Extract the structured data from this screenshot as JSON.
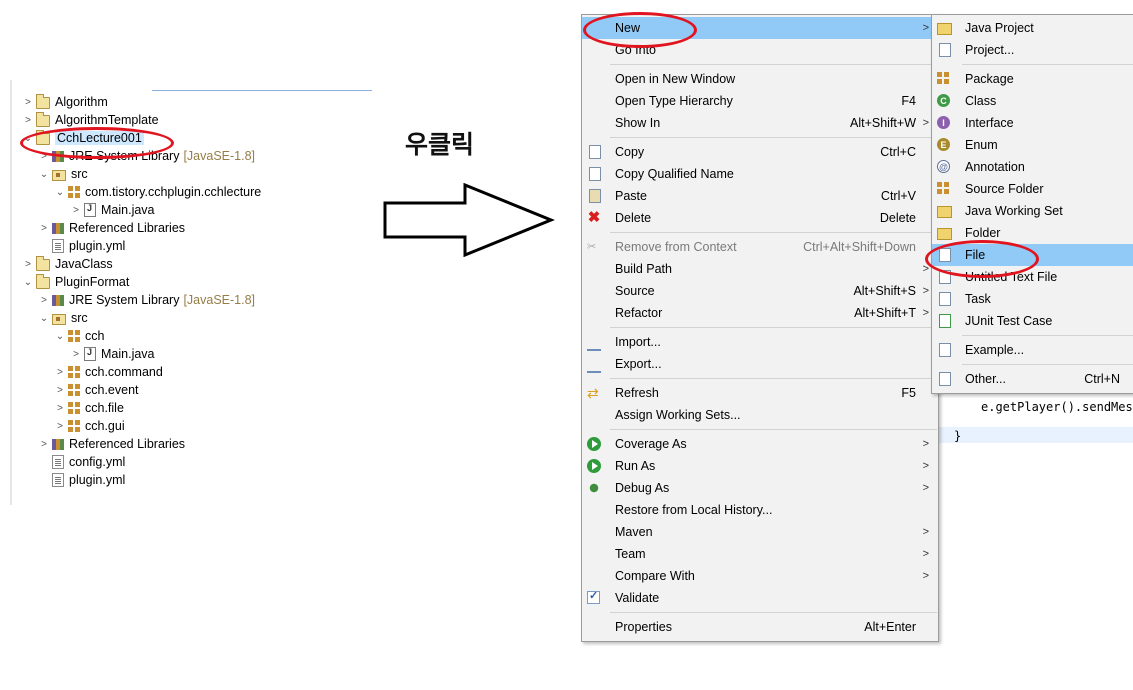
{
  "explorer": {
    "items": [
      {
        "label": "Algorithm",
        "decor": ""
      },
      {
        "label": "AlgorithmTemplate",
        "decor": ""
      },
      {
        "label": "CchLecture001",
        "decor": ""
      },
      {
        "label": "JRE System Library",
        "decor": "[JavaSE-1.8]"
      },
      {
        "label": "src",
        "decor": ""
      },
      {
        "label": "com.tistory.cchplugin.cchlecture",
        "decor": ""
      },
      {
        "label": "Main.java",
        "decor": ""
      },
      {
        "label": "Referenced Libraries",
        "decor": ""
      },
      {
        "label": "plugin.yml",
        "decor": ""
      },
      {
        "label": "JavaClass",
        "decor": ""
      },
      {
        "label": "PluginFormat",
        "decor": ""
      },
      {
        "label": "JRE System Library",
        "decor": "[JavaSE-1.8]"
      },
      {
        "label": "src",
        "decor": ""
      },
      {
        "label": "cch",
        "decor": ""
      },
      {
        "label": "Main.java",
        "decor": ""
      },
      {
        "label": "cch.command",
        "decor": ""
      },
      {
        "label": "cch.event",
        "decor": ""
      },
      {
        "label": "cch.file",
        "decor": ""
      },
      {
        "label": "cch.gui",
        "decor": ""
      },
      {
        "label": "Referenced Libraries",
        "decor": ""
      },
      {
        "label": "config.yml",
        "decor": ""
      },
      {
        "label": "plugin.yml",
        "decor": ""
      }
    ]
  },
  "annotation": {
    "right_click_label": "우클릭"
  },
  "context_menu": {
    "items": [
      {
        "label": "New",
        "shortcut": ""
      },
      {
        "label": "Go Into",
        "shortcut": ""
      },
      {
        "label": "Open in New Window",
        "shortcut": ""
      },
      {
        "label": "Open Type Hierarchy",
        "shortcut": "F4"
      },
      {
        "label": "Show In",
        "shortcut": "Alt+Shift+W"
      },
      {
        "label": "Copy",
        "shortcut": "Ctrl+C"
      },
      {
        "label": "Copy Qualified Name",
        "shortcut": ""
      },
      {
        "label": "Paste",
        "shortcut": "Ctrl+V"
      },
      {
        "label": "Delete",
        "shortcut": "Delete"
      },
      {
        "label": "Remove from Context",
        "shortcut": "Ctrl+Alt+Shift+Down"
      },
      {
        "label": "Build Path",
        "shortcut": ""
      },
      {
        "label": "Source",
        "shortcut": "Alt+Shift+S"
      },
      {
        "label": "Refactor",
        "shortcut": "Alt+Shift+T"
      },
      {
        "label": "Import...",
        "shortcut": ""
      },
      {
        "label": "Export...",
        "shortcut": ""
      },
      {
        "label": "Refresh",
        "shortcut": "F5"
      },
      {
        "label": "Assign Working Sets...",
        "shortcut": ""
      },
      {
        "label": "Coverage As",
        "shortcut": ""
      },
      {
        "label": "Run As",
        "shortcut": ""
      },
      {
        "label": "Debug As",
        "shortcut": ""
      },
      {
        "label": "Restore from Local History...",
        "shortcut": ""
      },
      {
        "label": "Maven",
        "shortcut": ""
      },
      {
        "label": "Team",
        "shortcut": ""
      },
      {
        "label": "Compare With",
        "shortcut": ""
      },
      {
        "label": "Validate",
        "shortcut": ""
      },
      {
        "label": "Properties",
        "shortcut": "Alt+Enter"
      }
    ]
  },
  "new_submenu": {
    "items": [
      {
        "label": "Java Project",
        "shortcut": ""
      },
      {
        "label": "Project...",
        "shortcut": ""
      },
      {
        "label": "Package",
        "shortcut": ""
      },
      {
        "label": "Class",
        "shortcut": ""
      },
      {
        "label": "Interface",
        "shortcut": ""
      },
      {
        "label": "Enum",
        "shortcut": ""
      },
      {
        "label": "Annotation",
        "shortcut": ""
      },
      {
        "label": "Source Folder",
        "shortcut": ""
      },
      {
        "label": "Java Working Set",
        "shortcut": ""
      },
      {
        "label": "Folder",
        "shortcut": ""
      },
      {
        "label": "File",
        "shortcut": ""
      },
      {
        "label": "Untitled Text File",
        "shortcut": ""
      },
      {
        "label": "Task",
        "shortcut": ""
      },
      {
        "label": "JUnit Test Case",
        "shortcut": ""
      },
      {
        "label": "Example...",
        "shortcut": ""
      },
      {
        "label": "Other...",
        "shortcut": "Ctrl+N"
      }
    ]
  },
  "editor": {
    "line1": "e.getPlayer().sendMess",
    "line2": "}"
  },
  "colors": {
    "highlight": "#91c9f7",
    "annotation_red": "#e0151f",
    "menu_bg": "#f2f2f2"
  }
}
